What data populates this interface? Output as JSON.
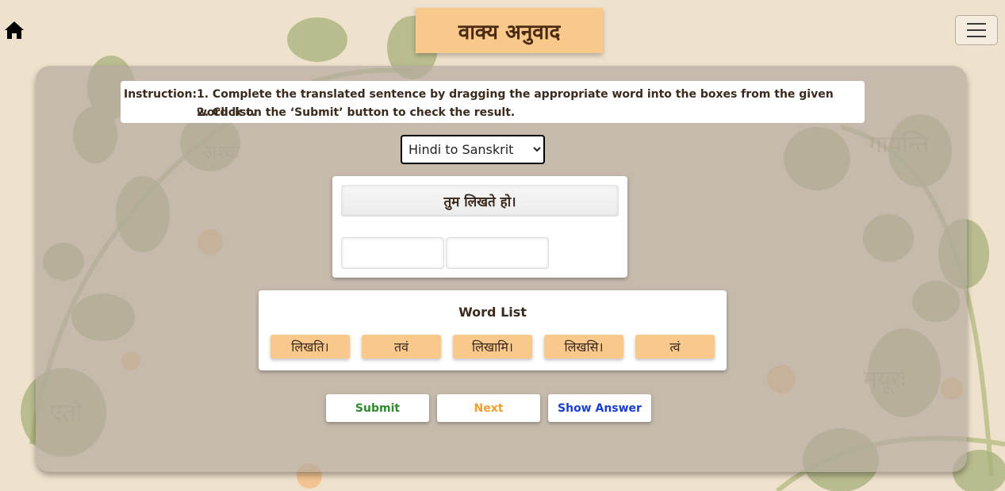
{
  "header": {
    "title": "वाक्य अनुवाद",
    "home_icon": "home-icon",
    "menu_icon": "hamburger-menu-icon"
  },
  "instruction": {
    "label": "Instruction:",
    "line1": "1. Complete the translated sentence by dragging the appropriate word into the boxes from the given word list.",
    "line2": "2. Click on the ‘Submit’ button to check the result."
  },
  "mode_select": {
    "selected": "Hindi to Sanskrit"
  },
  "sentence": {
    "text": "तुम लिखते हो।",
    "drop_boxes": [
      "",
      ""
    ]
  },
  "word_list": {
    "title": "Word List",
    "words": [
      "लिखति।",
      "तवं",
      "लिखामि।",
      "लिखसि।",
      "त्वं"
    ]
  },
  "buttons": {
    "submit": "Submit",
    "next": "Next",
    "show_answer": "Show Answer"
  },
  "colors": {
    "accent": "#f9c98b",
    "submit": "#2e8b2e",
    "next": "#f0a030",
    "show_answer": "#1a3fcf",
    "title_text": "#4a2a12"
  }
}
